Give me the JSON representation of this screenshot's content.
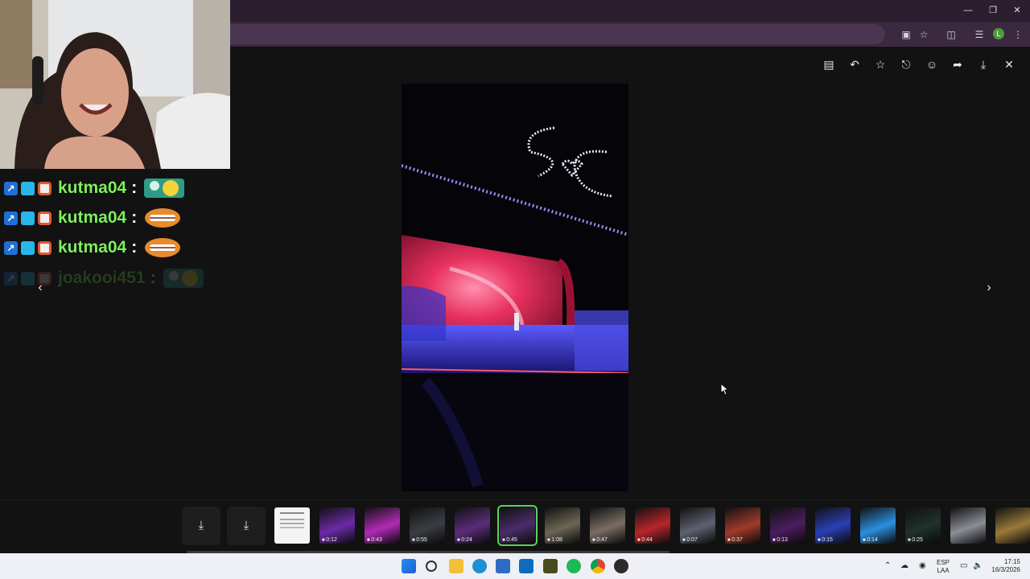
{
  "window": {
    "minimize_icon": "minimize-icon",
    "restore_icon": "restore-icon",
    "close_icon": "close-icon"
  },
  "browser_toolbar": {
    "icons": [
      "install-app-icon",
      "star-icon",
      "extensions-icon",
      "media-controls-icon",
      "menu-icon"
    ],
    "profile_initial": "L"
  },
  "viewer": {
    "tools": [
      "caption-icon",
      "reply-icon",
      "star-icon",
      "pin-icon",
      "emoji-icon",
      "forward-icon",
      "download-icon",
      "close-icon"
    ],
    "prev_icon": "chevron-left-icon",
    "next_icon": "chevron-right-icon"
  },
  "chat": {
    "messages": [
      {
        "user": "kutma04",
        "sep": ":",
        "emote": "yellow-pepe-emote"
      },
      {
        "user": "kutma04",
        "sep": ":",
        "emote": "laughing-face-emote"
      },
      {
        "user": "kutma04",
        "sep": ":",
        "emote": "laughing-face-emote"
      },
      {
        "user": "joakooi451",
        "sep": ":",
        "emote": "yellow-pepe-emote",
        "faded": true
      }
    ]
  },
  "filmstrip": {
    "thumbnails": [
      {
        "kind": "document",
        "duration": ""
      },
      {
        "kind": "video",
        "duration": "0:12",
        "color": "#6b2aa8"
      },
      {
        "kind": "video",
        "duration": "0:43",
        "color": "#b02bb5"
      },
      {
        "kind": "video",
        "duration": "0:55",
        "color": "#3a3d44"
      },
      {
        "kind": "video",
        "duration": "0:24",
        "color": "#5a2d7a"
      },
      {
        "kind": "video",
        "duration": "0:45",
        "color": "#4a2c6a",
        "selected": true
      },
      {
        "kind": "video",
        "duration": "1:08",
        "color": "#6d6655"
      },
      {
        "kind": "video",
        "duration": "0:47",
        "color": "#7a6e66"
      },
      {
        "kind": "video",
        "duration": "0:44",
        "color": "#b8262a"
      },
      {
        "kind": "video",
        "duration": "0:07",
        "color": "#5d6270"
      },
      {
        "kind": "video",
        "duration": "0:37",
        "color": "#a03a2a"
      },
      {
        "kind": "video",
        "duration": "0:13",
        "color": "#4b1d5e"
      },
      {
        "kind": "video",
        "duration": "0:15",
        "color": "#2a3fb5"
      },
      {
        "kind": "video",
        "duration": "0:14",
        "color": "#2b8fe0"
      },
      {
        "kind": "video",
        "duration": "0:25",
        "color": "#21312c"
      },
      {
        "kind": "video",
        "duration": "",
        "color": "#8a8e95"
      },
      {
        "kind": "video",
        "duration": "",
        "color": "#9a7a3a"
      }
    ]
  },
  "taskbar": {
    "apps": [
      "windows-start-icon",
      "search-icon",
      "file-explorer-icon",
      "edge-icon",
      "store-icon",
      "outlook-icon",
      "app-icon",
      "spotify-icon",
      "chrome-icon",
      "obs-icon"
    ],
    "language": "ESP",
    "layout": "LAA",
    "time": "17:15",
    "date": "16/3/2026"
  }
}
